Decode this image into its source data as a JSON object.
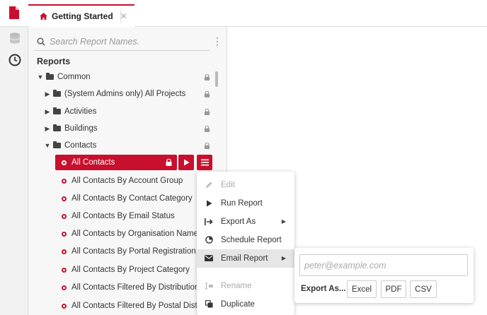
{
  "tabs": [
    {
      "label": "Getting Started",
      "icon": "home-icon",
      "close": "✕"
    }
  ],
  "panel": {
    "search_placeholder": "Search Report Names.",
    "section_title": "Reports",
    "tree": [
      {
        "label": "Common",
        "type": "folder",
        "expanded": true,
        "locked": true
      },
      {
        "label": "(System Admins only) All Projects",
        "type": "folder",
        "expanded": false,
        "locked": true
      },
      {
        "label": "Activities",
        "type": "folder",
        "expanded": false,
        "locked": true
      },
      {
        "label": "Buildings",
        "type": "folder",
        "expanded": false,
        "locked": true
      },
      {
        "label": "Contacts",
        "type": "folder",
        "expanded": true,
        "locked": true
      }
    ],
    "selected_report": "All Contacts",
    "reports": [
      "All Contacts By Account Group",
      "All Contacts By Contact Category",
      "All Contacts By Email Status",
      "All Contacts by Organisation Name",
      "All Contacts By Portal Registration ...",
      "All Contacts By Project Category",
      "All Contacts Filtered By Distribution",
      "All Contacts Filtered By Postal Distri"
    ]
  },
  "context_menu": {
    "items": [
      {
        "label": "Edit",
        "icon": "pencil-icon",
        "disabled": true
      },
      {
        "label": "Run Report",
        "icon": "play-icon",
        "disabled": false
      },
      {
        "label": "Export As",
        "icon": "export-icon",
        "disabled": false,
        "submenu": true
      },
      {
        "label": "Schedule Report",
        "icon": "clock-pie-icon",
        "disabled": false
      },
      {
        "label": "Email Report",
        "icon": "envelope-icon",
        "disabled": false,
        "submenu": true,
        "hover": true
      },
      {
        "label": "Rename",
        "icon": "rename-icon",
        "disabled": true
      },
      {
        "label": "Duplicate",
        "icon": "copy-icon",
        "disabled": false
      }
    ]
  },
  "email_submenu": {
    "placeholder": "peter@example.com",
    "export_label": "Export As...",
    "formats": [
      "Excel",
      "PDF",
      "CSV"
    ]
  },
  "colors": {
    "accent": "#c8102e",
    "panel_bg": "#f7f7f7",
    "menu_hover": "#e6e6e6"
  }
}
